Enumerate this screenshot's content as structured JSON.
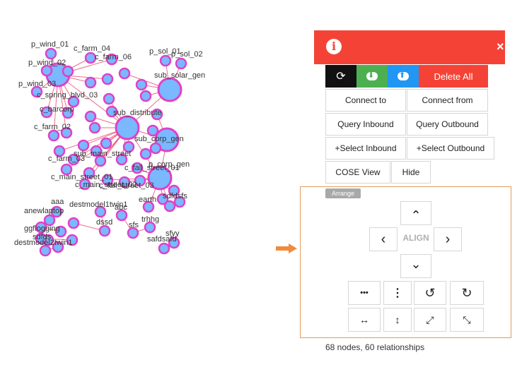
{
  "graph": {
    "node_color": "#e040c8",
    "node_fill": "#7ab8ff",
    "edge_color": "#e94a6e",
    "labels": [
      "p_wind_01",
      "c_farm_04",
      "p_sol_01",
      "p_sol_02",
      "p_wind_02",
      "c_farm_06",
      "p_wind_03",
      "sub_solar_gen",
      "c_spring_blvd_03",
      "c_barcorp",
      "sub_distribute",
      "sub_corp_gen",
      "c_farm_02",
      "c_farm_03",
      "sub_main_street",
      "c_fall_street_01",
      "c_main_street_01",
      "c_fall_street_03",
      "c_main_street_02",
      "p_corp_gen",
      "aaa",
      "anewlaptop",
      "destmodel1twin1",
      "ggflogging",
      "abc",
      "earth",
      "sdfds",
      "dssd",
      "trhhg",
      "sfs",
      "sfyy",
      "safdsafd",
      "destmodel2twin1",
      "sdfdsfs"
    ]
  },
  "panel": {
    "header_color": "#f44336",
    "info_icon": "info-icon",
    "close_icon": "×",
    "toolbar": {
      "refresh_icon": "⟳",
      "download_icon": "⬇",
      "upload_icon": "⬆",
      "delete_all": "Delete All",
      "colors": {
        "refresh": "#111111",
        "download": "#4caf50",
        "upload": "#2196f3",
        "delete": "#f44336"
      }
    },
    "buttons": {
      "connect_to": "Connect to",
      "connect_from": "Connect from",
      "query_inbound": "Query Inbound",
      "query_outbound": "Query Outbound",
      "select_inbound": "+Select Inbound",
      "select_outbound": "+Select Outbound",
      "cose_view": "COSE View",
      "hide": "Hide"
    },
    "arrange": {
      "tag": "Arrange",
      "align": "ALIGN",
      "up": "⌃",
      "down": "⌄",
      "left": "‹",
      "right": "›",
      "row1": [
        "•••",
        "⋮",
        "↺",
        "↻"
      ],
      "row2": [
        "↔",
        "↕",
        "⤢",
        "⤡"
      ]
    }
  },
  "status": "68 nodes, 60 relationships"
}
